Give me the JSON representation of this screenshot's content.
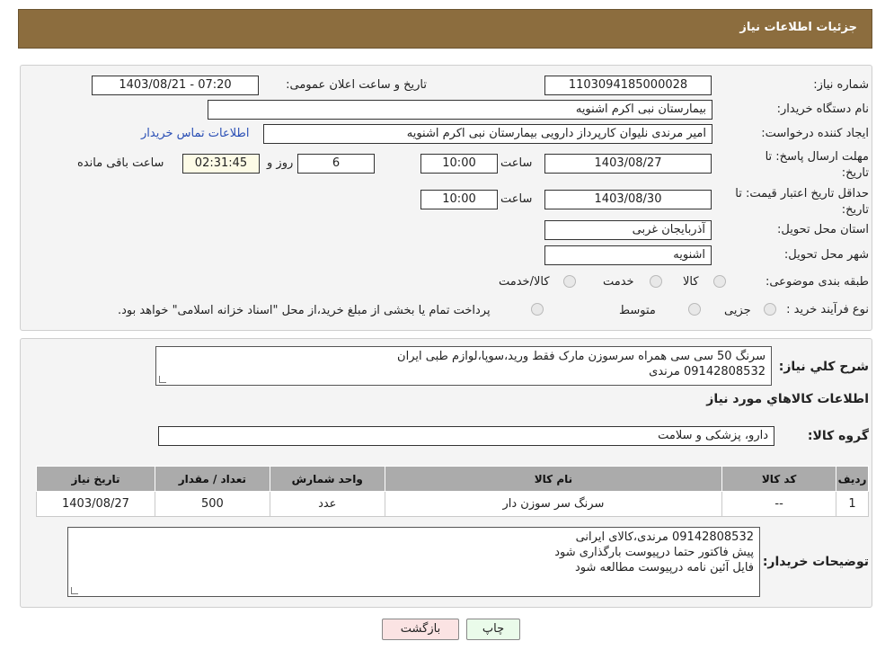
{
  "header": {
    "title": "جزئیات اطلاعات نیاز"
  },
  "form": {
    "need_number_label": "شماره نیاز:",
    "need_number": "1103094185000028",
    "announce_label": "تاریخ و ساعت اعلان عمومی:",
    "announce_value": "1403/08/21 - 07:20",
    "buyer_org_label": "نام دستگاه خریدار:",
    "buyer_org": "بیمارستان نبی اکرم اشنویه",
    "requester_label": "ایجاد کننده درخواست:",
    "requester": "امیر مرندی نلیوان کارپرداز دارویی بیمارستان نبی اکرم اشنویه",
    "contact_link": "اطلاعات تماس خریدار",
    "deadline_label_1": "مهلت ارسال پاسخ: تا",
    "deadline_label_2": "تاریخ:",
    "deadline_date": "1403/08/27",
    "hour_label": "ساعت",
    "deadline_time": "10:00",
    "days_value": "6",
    "days_label": "روز و",
    "remaining_time": "02:31:45",
    "remaining_label": "ساعت باقی مانده",
    "validity_label_1": "حداقل تاریخ اعتبار قیمت: تا",
    "validity_label_2": "تاریخ:",
    "validity_date": "1403/08/30",
    "validity_time": "10:00",
    "province_label": "استان محل تحویل:",
    "province": "آذربایجان غربی",
    "city_label": "شهر محل تحویل:",
    "city": "اشنویه",
    "category_label": "طبقه بندی موضوعی:",
    "category_options": [
      "کالا",
      "خدمت",
      "کالا/خدمت"
    ],
    "process_label": "نوع فرآیند خرید :",
    "process_options": [
      "جزیی",
      "متوسط"
    ],
    "process_note": "پرداخت تمام یا بخشی از مبلغ خرید،از محل \"اسناد خزانه اسلامی\" خواهد بود."
  },
  "description": {
    "label": "شرح کلي نیاز:",
    "line1": "سرنگ 50 سی سی همراه سرسوزن مارک فقط ورید،سوپا،لوازم طبی ایران",
    "line2": "09142808532 مرندی"
  },
  "goods": {
    "section_title": "اطلاعات کالاهاي مورد نياز",
    "group_label": "گروه کالا:",
    "group_value": "دارو، پزشکی و سلامت",
    "columns": [
      "ردیف",
      "کد کالا",
      "نام کالا",
      "واحد شمارش",
      "تعداد / مقدار",
      "تاریخ نیاز"
    ],
    "rows": [
      [
        "1",
        "--",
        "سرنگ سر سوزن دار",
        "عدد",
        "500",
        "1403/08/27"
      ]
    ]
  },
  "buyer_notes": {
    "label": "توضیحات خریدار:",
    "line1": "09142808532 مرندی،کالای ایرانی",
    "line2": "پیش فاکتور حتما درپیوست بارگذاری شود",
    "line3": "فایل آئین نامه درپیوست مطالعه شود"
  },
  "buttons": {
    "print": "چاپ",
    "back": "بازگشت"
  },
  "colors": {
    "header_bg": "#8c6d3e",
    "print_bg": "#eafbea",
    "back_bg": "#fbe3e3",
    "link": "#2a4fb5"
  }
}
